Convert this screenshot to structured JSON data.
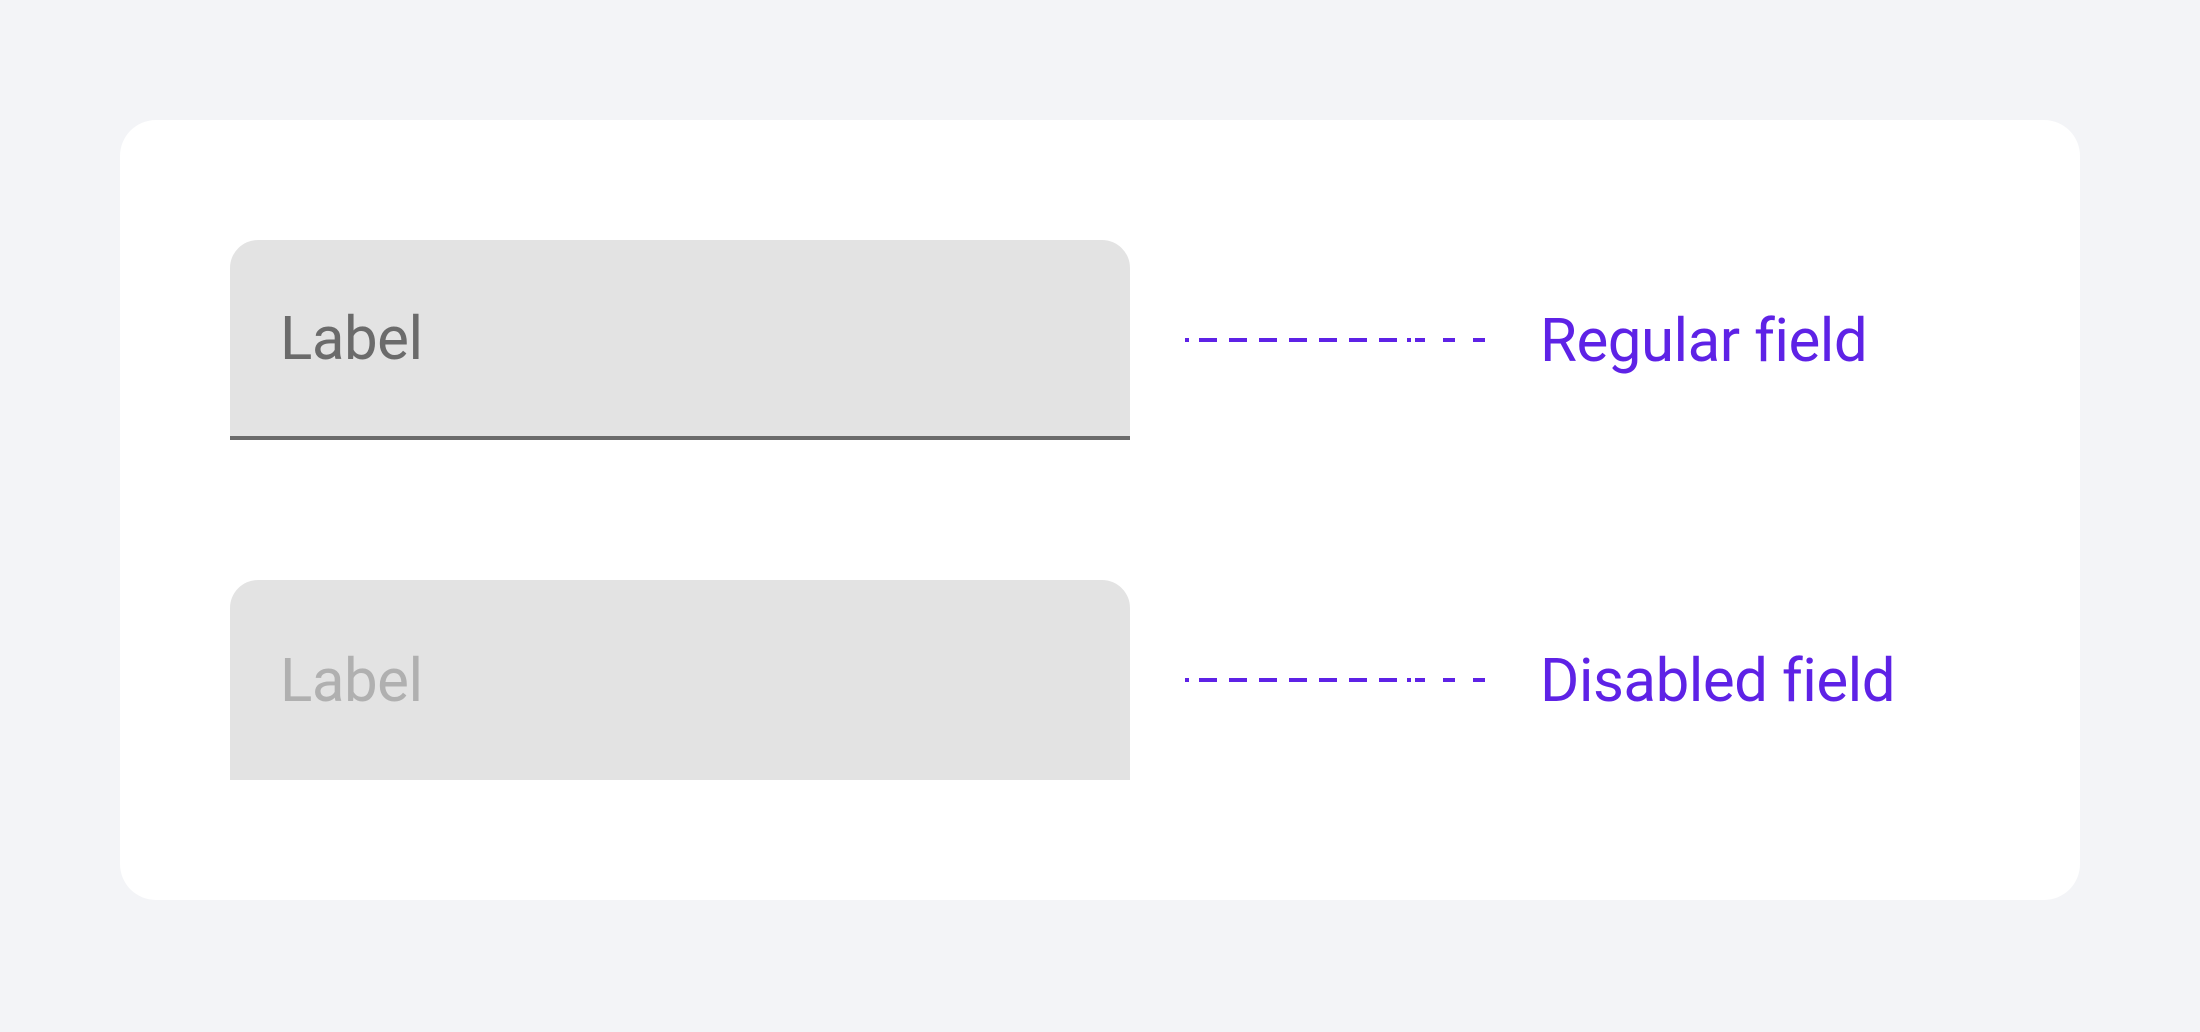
{
  "fields": {
    "regular": {
      "label": "Label",
      "annotation": "Regular field"
    },
    "disabled": {
      "label": "Label",
      "annotation": "Disabled  field"
    }
  },
  "colors": {
    "accent": "#5e22e6",
    "field_bg": "#e3e3e3",
    "label_regular": "#6b6b6b",
    "label_disabled": "#b0b0b0",
    "underline": "#6b6b6b"
  }
}
